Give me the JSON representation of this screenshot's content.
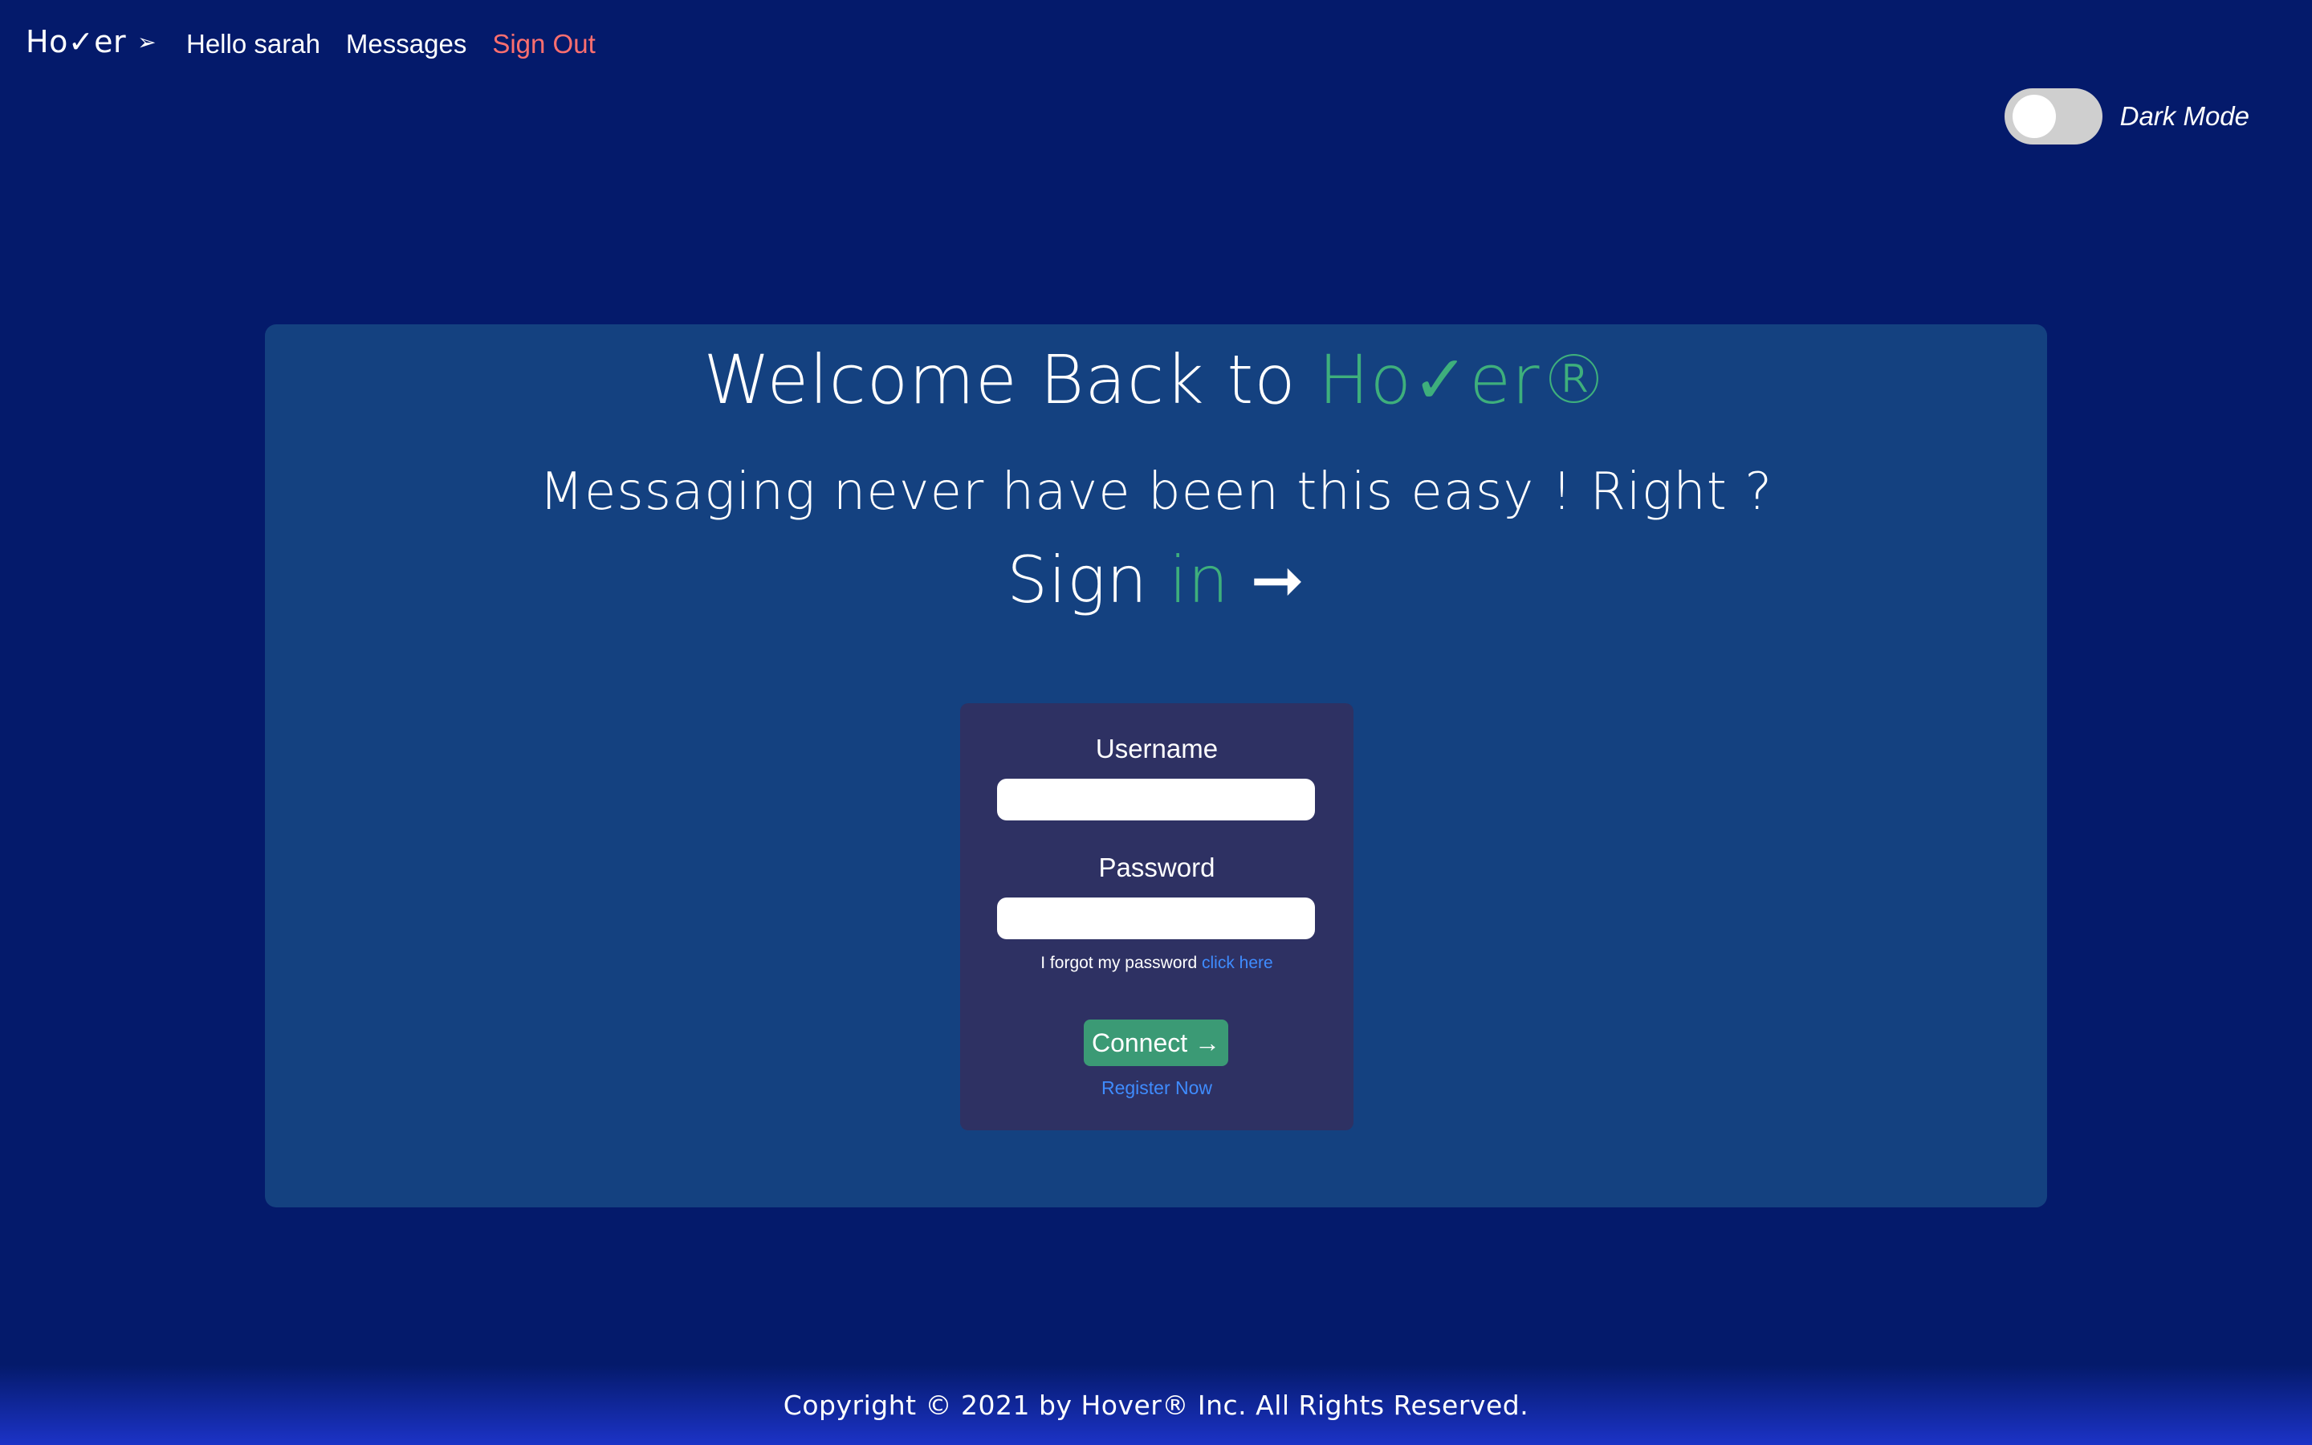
{
  "navbar": {
    "brand": "Ho✓er",
    "brand_icon": "arrow-icon",
    "links": [
      {
        "label": "Hello sarah"
      },
      {
        "label": "Messages"
      },
      {
        "label": "Sign Out",
        "color": "#ff6f6f"
      }
    ]
  },
  "dark_mode": {
    "label": "Dark Mode",
    "enabled": false
  },
  "hero": {
    "welcome_prefix": "Welcome Back to ",
    "welcome_brand": "Ho✓er®",
    "tagline": "Messaging never have been this easy ! Right ?",
    "signin_word": "Sign ",
    "signin_accent": "in",
    "signin_arrow": "➞"
  },
  "login": {
    "username_label": "Username",
    "username_value": "",
    "password_label": "Password",
    "password_value": "",
    "forgot_text": "I forgot my password ",
    "forgot_link": "click here",
    "connect_label": "Connect →",
    "register_label": "Register Now"
  },
  "footer": {
    "copyright": "Copyright © 2021 by Hover® Inc. All Rights Reserved."
  },
  "colors": {
    "background": "#041a6b",
    "panel": "#144180",
    "card": "#2e3163",
    "accent_green": "#3eaf7c",
    "button_green": "#3b9a75",
    "link_blue": "#3f8cff",
    "signout_red": "#ff6f6f"
  }
}
